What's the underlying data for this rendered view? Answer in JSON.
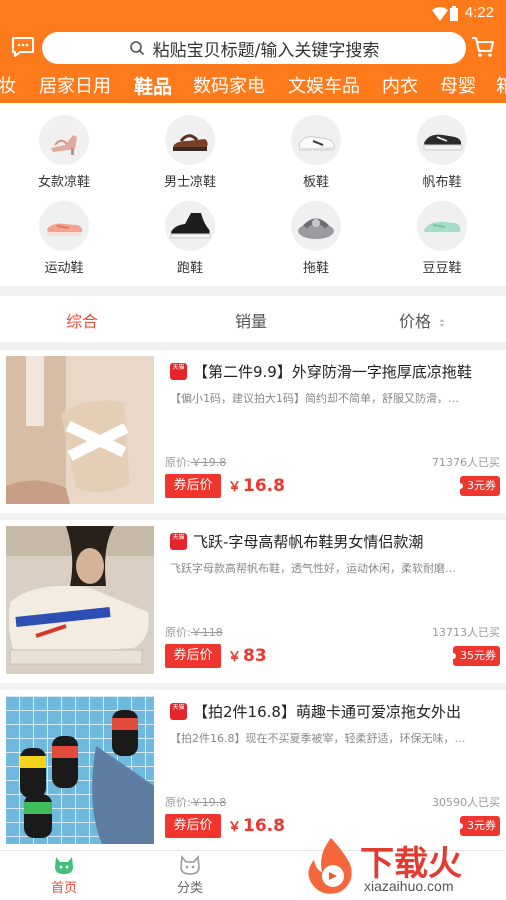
{
  "status": {
    "time": "4:22"
  },
  "header": {
    "search_placeholder": "粘贴宝贝标题/输入关键字搜索",
    "message_icon": "message-icon",
    "cart_icon": "cart-icon",
    "accent_color": "#ff7a1a",
    "tabs": [
      {
        "label": "妆"
      },
      {
        "label": "居家日用"
      },
      {
        "label": "鞋品",
        "active": true
      },
      {
        "label": "数码家电"
      },
      {
        "label": "文娱车品"
      },
      {
        "label": "内衣"
      },
      {
        "label": "母婴"
      },
      {
        "label": "箱"
      }
    ]
  },
  "subcategories": [
    {
      "label": "女款凉鞋",
      "icon": "sandal-icon"
    },
    {
      "label": "男士凉鞋",
      "icon": "sandal-icon"
    },
    {
      "label": "板鞋",
      "icon": "sneaker-icon"
    },
    {
      "label": "帆布鞋",
      "icon": "canvas-shoe-icon"
    },
    {
      "label": "运动鞋",
      "icon": "sport-shoe-icon"
    },
    {
      "label": "跑鞋",
      "icon": "running-shoe-icon"
    },
    {
      "label": "拖鞋",
      "icon": "slipper-icon"
    },
    {
      "label": "豆豆鞋",
      "icon": "loafer-icon"
    }
  ],
  "sort": {
    "items": [
      {
        "label": "综合",
        "active": true
      },
      {
        "label": "销量"
      },
      {
        "label": "价格"
      }
    ],
    "active_color": "#f04a38"
  },
  "products": [
    {
      "badge": "天猫",
      "title": "【第二件9.9】外穿防滑一字拖厚底凉拖鞋",
      "desc": "【偏小1码，建议拍大1码】简约却不简单，舒服又防滑，…",
      "orig_label": "原价:",
      "orig_price": "￥19.8",
      "sold": "71376人已买",
      "after_label": "券后价",
      "yen": "￥",
      "price": "16.8",
      "coupon": "3元券"
    },
    {
      "badge": "天猫",
      "title": "飞跃-字母高帮帆布鞋男女情侣款潮",
      "desc": "飞跃字母款高帮帆布鞋，透气性好，运动休闲，柔软耐磨…",
      "orig_label": "原价:",
      "orig_price": "￥118",
      "sold": "13713人已买",
      "after_label": "券后价",
      "yen": "￥",
      "price": "83",
      "coupon": "35元券"
    },
    {
      "badge": "天猫",
      "title": "【拍2件16.8】萌趣卡通可爱凉拖女外出",
      "desc": "【拍2件16.8】现在不买夏季被宰，轻柔舒适，环保无味，…",
      "orig_label": "原价:",
      "orig_price": "￥19.8",
      "sold": "30590人已买",
      "after_label": "券后价",
      "yen": "￥",
      "price": "16.8",
      "coupon": "3元券"
    }
  ],
  "bottom_nav": [
    {
      "label": "首页",
      "icon": "home-cat-icon",
      "active": true
    },
    {
      "label": "分类",
      "icon": "category-cat-icon"
    }
  ],
  "watermark": {
    "text": "下载火",
    "url": "xiazaihuo.com"
  }
}
